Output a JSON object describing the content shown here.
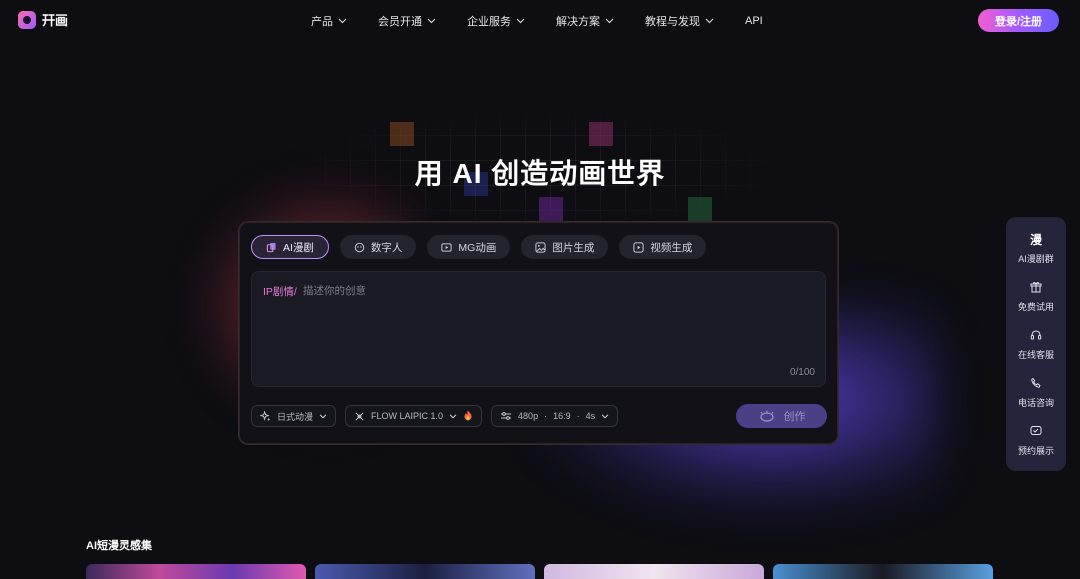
{
  "brand": {
    "name": "幵画"
  },
  "nav": {
    "items": [
      {
        "label": "产品",
        "has_dropdown": true
      },
      {
        "label": "会员开通",
        "has_dropdown": true
      },
      {
        "label": "企业服务",
        "has_dropdown": true
      },
      {
        "label": "解决方案",
        "has_dropdown": true
      },
      {
        "label": "教程与发现",
        "has_dropdown": true
      },
      {
        "label": "API",
        "has_dropdown": false
      }
    ],
    "login_label": "登录/注册"
  },
  "hero": {
    "title": "用 AI 创造动画世界"
  },
  "creator": {
    "tabs": [
      {
        "label": "AI漫剧",
        "icon": "ai-comic-icon",
        "active": true
      },
      {
        "label": "数字人",
        "icon": "digital-human-icon",
        "active": false
      },
      {
        "label": "MG动画",
        "icon": "mg-animation-icon",
        "active": false
      },
      {
        "label": "图片生成",
        "icon": "image-icon",
        "active": false
      },
      {
        "label": "视频生成",
        "icon": "video-icon",
        "active": false
      }
    ],
    "prompt": {
      "prefix": "IP剧情/",
      "placeholder": "描述你的创意",
      "value": "",
      "counter": "0/100"
    },
    "controls": {
      "style": "日式动漫",
      "model": "FLOW LAIPIC 1.0",
      "resolution": "480p",
      "ratio": "16:9",
      "duration": "4s"
    },
    "create_label": "创作"
  },
  "side_panel": {
    "items": [
      {
        "label": "AI漫剧群",
        "icon": "manhua-logo-icon",
        "glyph": "漫"
      },
      {
        "label": "免费试用",
        "icon": "gift-icon"
      },
      {
        "label": "在线客服",
        "icon": "headset-icon"
      },
      {
        "label": "电话咨询",
        "icon": "phone-icon"
      },
      {
        "label": "预约展示",
        "icon": "chat-calendar-icon"
      }
    ]
  },
  "section": {
    "title": "AI短漫灵感集"
  },
  "colors": {
    "background": "#0d0d12",
    "accent_pink": "#f35fd0",
    "accent_purple": "#a25bff",
    "tab_active_border": "#b892ff",
    "prompt_prefix": "#e37bd6",
    "create_button": "#4b3f86"
  }
}
